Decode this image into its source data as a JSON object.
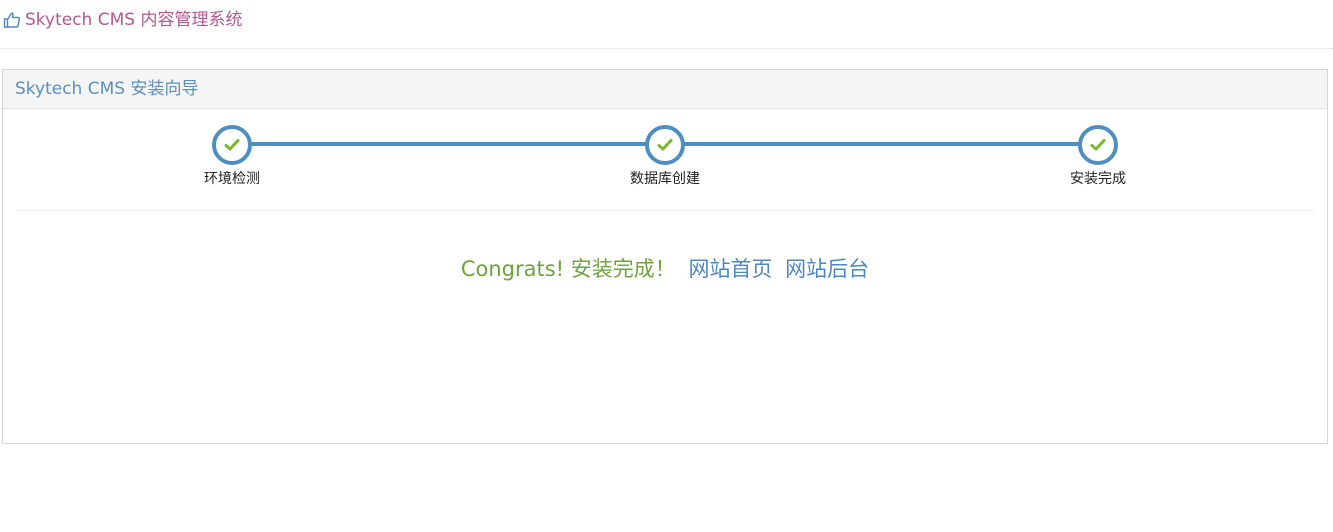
{
  "header": {
    "icon": "thumbs-up-icon",
    "title": "Skytech CMS 内容管理系统"
  },
  "panel": {
    "title": "Skytech CMS 安装向导"
  },
  "steps": [
    {
      "label": "环境检测",
      "icon": "check-icon",
      "status": "done"
    },
    {
      "label": "数据库创建",
      "icon": "check-icon",
      "status": "done"
    },
    {
      "label": "安装完成",
      "icon": "check-icon",
      "status": "done"
    }
  ],
  "message": {
    "congrats": "Congrats! 安装完成！",
    "links": [
      "网站首页",
      "网站后台"
    ]
  },
  "colors": {
    "header_title": "#b3588f",
    "accent_blue": "#4f8fbf",
    "check_green": "#7ab829",
    "congrats_green": "#6ea33d"
  }
}
